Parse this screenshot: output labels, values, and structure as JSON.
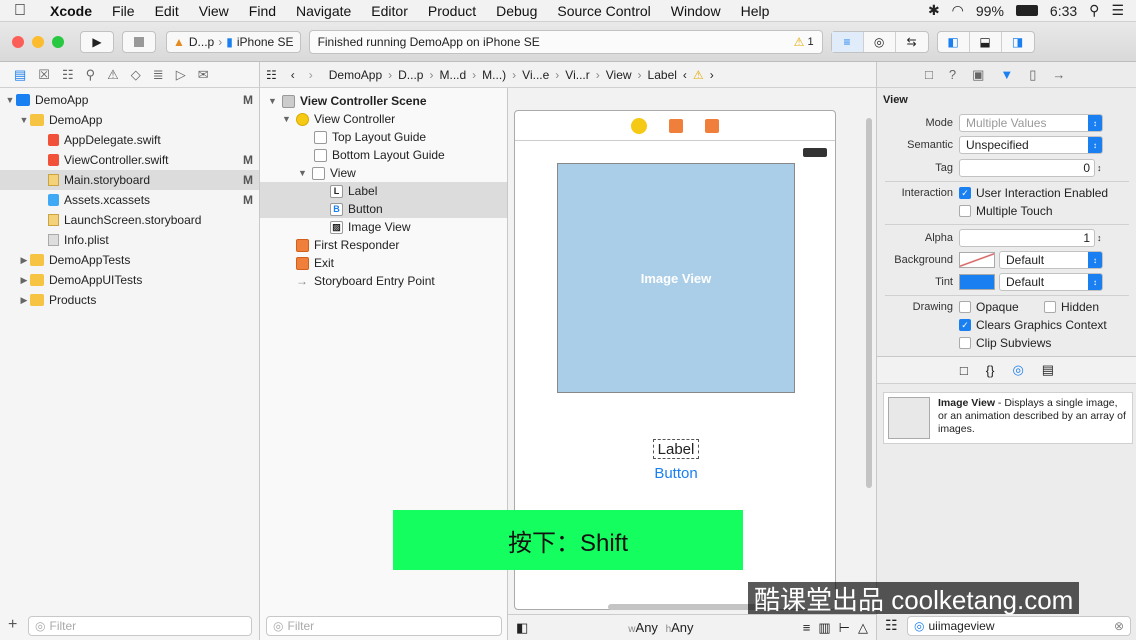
{
  "menubar": {
    "app": "Xcode",
    "items": [
      "File",
      "Edit",
      "View",
      "Find",
      "Navigate",
      "Editor",
      "Product",
      "Debug",
      "Source Control",
      "Window",
      "Help"
    ],
    "battery": "99%",
    "time": "6:33"
  },
  "toolbar": {
    "scheme": "D...p",
    "device": "iPhone SE",
    "status": "Finished running DemoApp on iPhone SE",
    "warnings": "1"
  },
  "navigator": {
    "rows": [
      {
        "label": "DemoApp",
        "badge": "M"
      },
      {
        "label": "DemoApp",
        "badge": ""
      },
      {
        "label": "AppDelegate.swift",
        "badge": ""
      },
      {
        "label": "ViewController.swift",
        "badge": "M"
      },
      {
        "label": "Main.storyboard",
        "badge": "M"
      },
      {
        "label": "Assets.xcassets",
        "badge": "M"
      },
      {
        "label": "LaunchScreen.storyboard",
        "badge": ""
      },
      {
        "label": "Info.plist",
        "badge": ""
      },
      {
        "label": "DemoAppTests",
        "badge": ""
      },
      {
        "label": "DemoAppUITests",
        "badge": ""
      },
      {
        "label": "Products",
        "badge": ""
      }
    ],
    "filter_placeholder": "Filter"
  },
  "jumpbar": [
    "DemoApp",
    "D...p",
    "M...d",
    "M...)",
    "Vi...e",
    "Vi...r",
    "View",
    "Label"
  ],
  "outline": {
    "rows": [
      {
        "label": "View Controller Scene"
      },
      {
        "label": "View Controller"
      },
      {
        "label": "Top Layout Guide"
      },
      {
        "label": "Bottom Layout Guide"
      },
      {
        "label": "View"
      },
      {
        "label": "Label"
      },
      {
        "label": "Button"
      },
      {
        "label": "Image View"
      },
      {
        "label": "First Responder"
      },
      {
        "label": "Exit"
      },
      {
        "label": "Storyboard Entry Point"
      }
    ],
    "filter_placeholder": "Filter"
  },
  "canvas": {
    "image_view_label": "Image View",
    "label_text": "Label",
    "button_text": "Button",
    "size_class_w": "Any",
    "size_class_h": "Any",
    "w_prefix": "w",
    "h_prefix": "h"
  },
  "inspector": {
    "section": "View",
    "mode_label": "Mode",
    "mode_value": "Multiple Values",
    "semantic_label": "Semantic",
    "semantic_value": "Unspecified",
    "tag_label": "Tag",
    "tag_value": "0",
    "interaction_label": "Interaction",
    "user_interaction": "User Interaction Enabled",
    "multiple_touch": "Multiple Touch",
    "alpha_label": "Alpha",
    "alpha_value": "1",
    "background_label": "Background",
    "background_value": "Default",
    "tint_label": "Tint",
    "tint_value": "Default",
    "drawing_label": "Drawing",
    "opaque": "Opaque",
    "hidden": "Hidden",
    "clears": "Clears Graphics Context",
    "clip": "Clip Subviews",
    "library_title": "Image View",
    "library_desc": " - Displays a single image, or an animation described by an array of images.",
    "search_value": "uiimageview"
  },
  "overlay": {
    "text": "按下：Shift"
  },
  "watermark": {
    "text": "酷课堂出品 coolketang.com"
  }
}
